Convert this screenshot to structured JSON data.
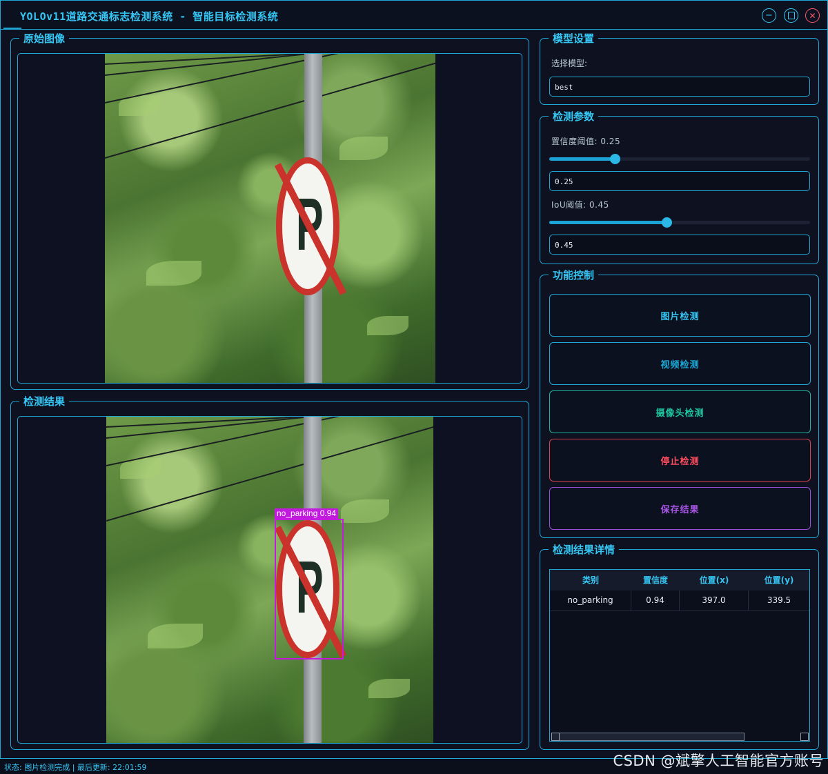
{
  "window": {
    "title": "YOLOv11道路交通标志检测系统 - 智能目标检测系统",
    "minimize_icon": "minimize-icon",
    "maximize_icon": "maximize-icon",
    "close_icon": "close-icon"
  },
  "original_panel": {
    "title": "原始图像"
  },
  "result_panel": {
    "title": "检测结果",
    "detection_label": "no_parking 0.94"
  },
  "model_settings": {
    "title": "模型设置",
    "select_label": "选择模型:",
    "selected_model": "best"
  },
  "detection_params": {
    "title": "检测参数",
    "confidence_label": "置信度阈值: 0.25",
    "confidence_value": "0.25",
    "confidence_level": 0.25,
    "iou_label": "IoU阈值: 0.45",
    "iou_value": "0.45",
    "iou_level": 0.45
  },
  "controls": {
    "title": "功能控制",
    "image_detect": "图片检测",
    "video_detect": "视频检测",
    "camera_detect": "摄像头检测",
    "stop_detect": "停止检测",
    "save_results": "保存结果"
  },
  "results_table": {
    "title": "检测结果详情",
    "headers": [
      "类别",
      "置信度",
      "位置(x)",
      "位置(y)"
    ],
    "rows": [
      [
        "no_parking",
        "0.94",
        "397.0",
        "339.5"
      ]
    ]
  },
  "status_bar": {
    "text": "状态: 图片检测完成 | 最后更新: 22:01:59"
  },
  "watermark": "CSDN @斌擎人工智能官方账号",
  "colors": {
    "accent": "#1fa7d8",
    "title": "#35c6f3",
    "video_button": "#1fa7d8",
    "camera_button": "#1fc7a0",
    "stop_button": "#ff4d5e",
    "save_button": "#a955e8",
    "bbox": "#c21bdd"
  }
}
